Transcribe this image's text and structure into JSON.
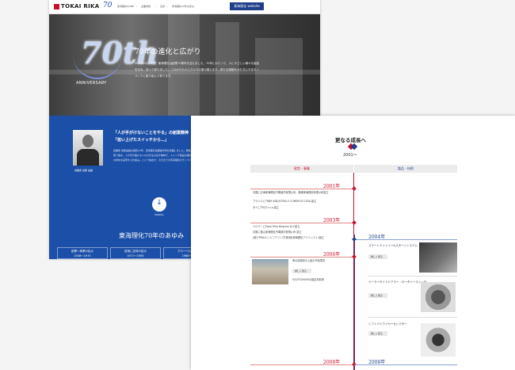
{
  "header": {
    "brand": "TOKAI RIKA",
    "anniversary_mark": "70",
    "breadcrumbs": [
      "東海理化HOME",
      "企業情報",
      "沿革",
      "東海理化70年の歩み"
    ],
    "global_site_button": "東海理化 website"
  },
  "hero": {
    "anniversary_number": "70th",
    "anniversary_word": "ANNIVERSARY",
    "title": "70年の進化と広がり",
    "paragraph": "2018年8月18日、東海理化は創業70周年を迎えました。70年にわたって、人にやさしい様々な製品を生み、送って参りました。これからも人とクルマの架け橋となり、新たな感動をかたちにするモノづくりに取り組んで参ります。"
  },
  "founder": {
    "caption": "創業者 加藤 由雄",
    "quote_line1": "「人が手がけないことをやる」の創業精神",
    "quote_line2": "「担い上げたスイッチから…」",
    "paragraph": "創業者 加藤由雄は昭和23年、東海理化電機製作所を創業しました。戦後の混乱期に自動車用スイッチの開発に取り組み、人の手が届かないものを生み出す精神で、スイッチ製品の礎を築きました。「スイッチ製品はお客様の求めを実現する仕組み」という信念が、今日までの東海理化のモノづくりを支えています。"
  },
  "scroll": {
    "label": "SCROLL",
    "arrow": "↓"
  },
  "history": {
    "heading": "東海理化70年のあゆみ",
    "eras": [
      {
        "title": "創業〜事業の拡大",
        "years": "1948〜1970"
      },
      {
        "title": "技術に定評の拡大",
        "years": "1971〜1985"
      },
      {
        "title": "グローバル企業へ",
        "years": "1986〜20"
      }
    ]
  },
  "growth": {
    "title": "更なる成長へ",
    "era": "2001〜",
    "col_left": "経営・事業",
    "col_right": "製品・技術",
    "years": {
      "y2001": "2001年",
      "y2003": "2003年",
      "y2004": "2004年",
      "y2006": "2006年",
      "y2008a": "2008年",
      "y2008b": "2008年"
    },
    "items_2001": [
      "中国に天津東海理化汽車部件有限公司、無錫東海理化有限公司設立",
      "ブラジルにTRBR INDUSTRIA E COMERCIO LTDA.設立",
      "タイにTRCZ s.r.o.設立"
    ],
    "items_2003": [
      "ベルギーにTokai Rika Belgium N.V.設立",
      "中国に佛山東海理化汽車部件有限公司 設立",
      "(株)TRMAエンジニアリング(現(株)東海理化アドバンスト)設立"
    ],
    "items_2006": [
      "東公民館前の上組の市長表彰",
      "ISO/TS16949の認証を取得"
    ],
    "products_2004": [
      "スマートエントリー&スタートシステム",
      "ミーラーサイドドアラー・ロータリースイッチ",
      "シフトバイワイヤーセレクター"
    ],
    "detail_label": "詳しく見る"
  }
}
